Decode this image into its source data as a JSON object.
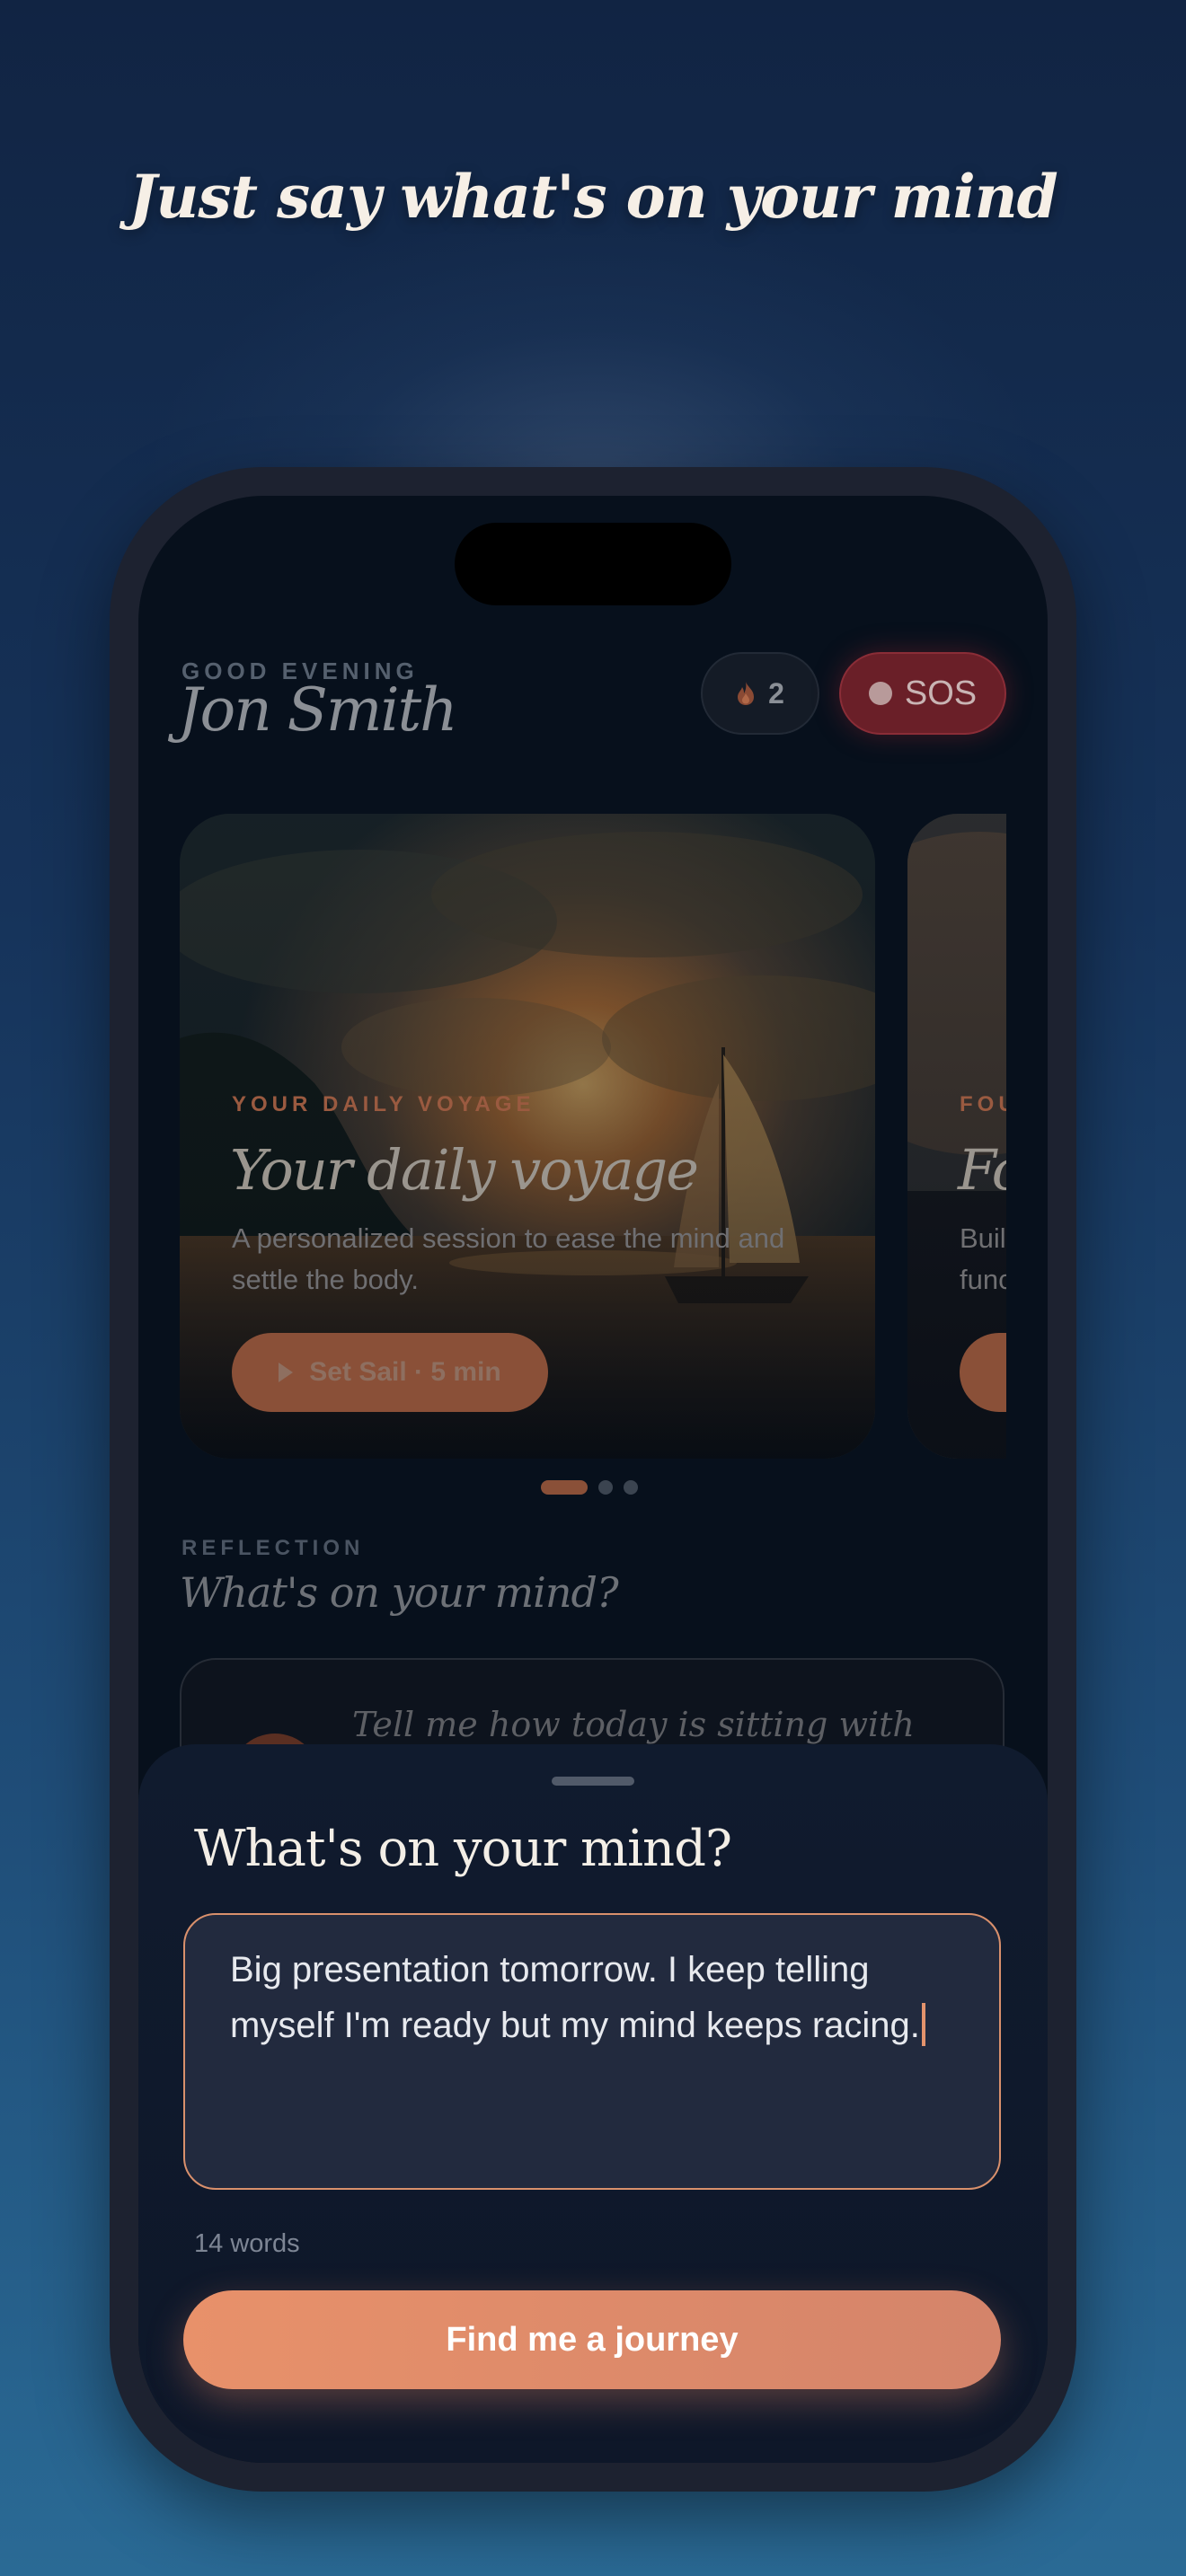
{
  "promo": {
    "headline": "Just say what's on your mind"
  },
  "header": {
    "greeting": "GOOD EVENING",
    "user_name": "Jon Smith",
    "streak_count": "2",
    "streak_icon": "flame-icon",
    "sos_label": "SOS"
  },
  "cards": [
    {
      "eyebrow": "YOUR DAILY VOYAGE",
      "title": "Your daily voyage",
      "description": "A personalized session to ease the mind and settle the body.",
      "button_label": "Set Sail · 5 min"
    },
    {
      "eyebrow": "FOU",
      "title": "Fo",
      "description": "Buil func"
    }
  ],
  "carousel": {
    "total": 3,
    "active_index": 0
  },
  "reflection": {
    "label": "REFLECTION",
    "title": "What's on your mind?",
    "prompt": "Tell me how today is sitting with"
  },
  "sheet": {
    "title": "What's on your mind?",
    "input_value": "Big presentation tomorrow. I keep telling myself I'm ready but my mind keeps racing.",
    "word_count": "14 words",
    "cta_label": "Find me a journey"
  },
  "colors": {
    "accent": "#E8916A",
    "sos": "#6A1F28",
    "sheet_bg": "#101B2E",
    "input_bg": "#222A3E"
  }
}
